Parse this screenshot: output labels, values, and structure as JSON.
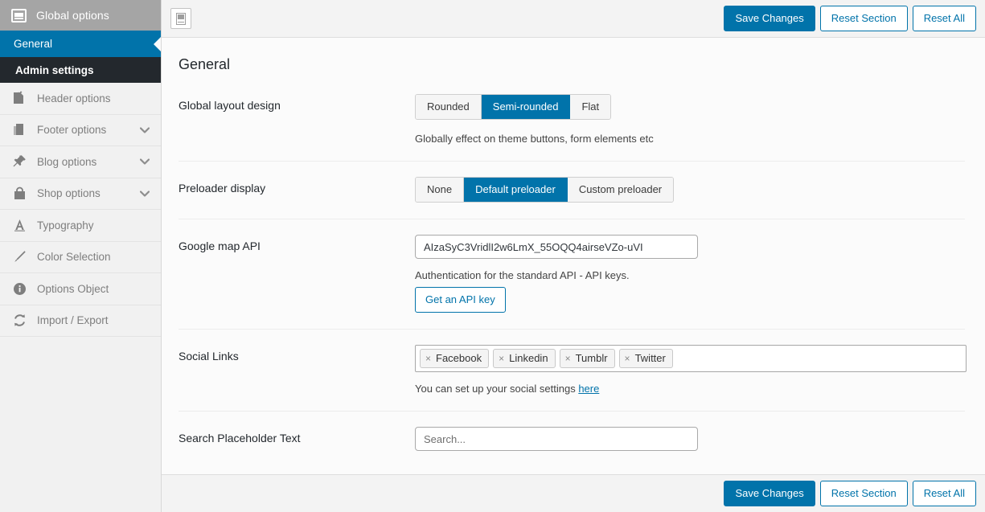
{
  "sidebar": {
    "header": {
      "title": "Global options",
      "icon": "global-options-icon"
    },
    "active_item": {
      "label": "General"
    },
    "active_sub_item": {
      "label": "Admin settings"
    },
    "items": [
      {
        "label": "Header options",
        "icon": "page-pin-icon",
        "has_chevron": false
      },
      {
        "label": "Footer options",
        "icon": "copy-pages-icon",
        "has_chevron": true
      },
      {
        "label": "Blog options",
        "icon": "pushpin-icon",
        "has_chevron": true
      },
      {
        "label": "Shop options",
        "icon": "shopping-bag-icon",
        "has_chevron": true
      },
      {
        "label": "Typography",
        "icon": "letter-a-icon",
        "has_chevron": false
      },
      {
        "label": "Color Selection",
        "icon": "paintbrush-icon",
        "has_chevron": false
      },
      {
        "label": "Options Object",
        "icon": "info-circle-icon",
        "has_chevron": false
      },
      {
        "label": "Import / Export",
        "icon": "refresh-arrows-icon",
        "has_chevron": false
      }
    ]
  },
  "topbar": {
    "expand_icon": "expand-panel-icon",
    "save_label": "Save Changes",
    "reset_section_label": "Reset Section",
    "reset_all_label": "Reset All"
  },
  "footer": {
    "save_label": "Save Changes",
    "reset_section_label": "Reset Section",
    "reset_all_label": "Reset All"
  },
  "main": {
    "page_title": "General",
    "fields": {
      "layout": {
        "label": "Global layout design",
        "options": [
          "Rounded",
          "Semi-rounded",
          "Flat"
        ],
        "selected": "Semi-rounded",
        "help": "Globally effect on theme buttons, form elements etc"
      },
      "preloader": {
        "label": "Preloader display",
        "options": [
          "None",
          "Default preloader",
          "Custom preloader"
        ],
        "selected": "Default preloader"
      },
      "google_map": {
        "label": "Google map API",
        "value": "AIzaSyC3VridlI2w6LmX_55OQQ4airseVZo-uVI",
        "placeholder": "",
        "help": "Authentication for the standard API - API keys.",
        "button_label": "Get an API key"
      },
      "social_links": {
        "label": "Social Links",
        "tags": [
          "Facebook",
          "Linkedin",
          "Tumblr",
          "Twitter"
        ],
        "remove_glyph": "×",
        "help_prefix": "You can set up your social settings ",
        "help_link": "here"
      },
      "search_placeholder": {
        "label": "Search Placeholder Text",
        "value": "",
        "placeholder": "Search..."
      }
    }
  },
  "colors": {
    "accent": "#0173aa",
    "sidebar_bg": "#f1f1f1",
    "sidebar_header_bg": "#a5a5a5",
    "sub_nav_bg": "#23282d",
    "content_bg": "#fbfbfb",
    "bar_bg": "#f3f3f3"
  }
}
